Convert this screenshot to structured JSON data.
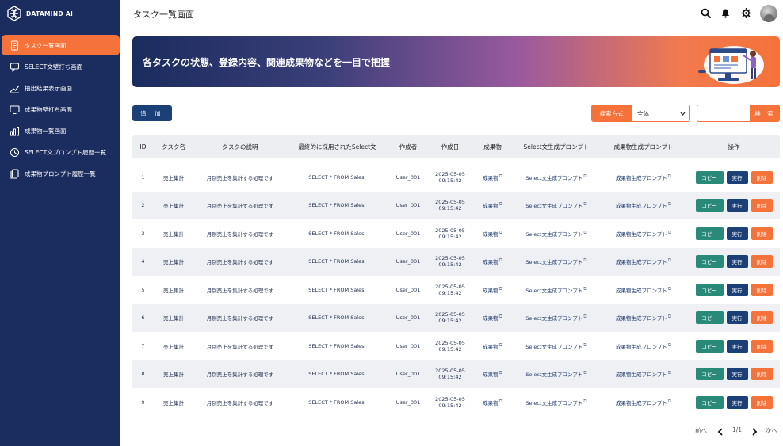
{
  "brand": {
    "name": "DATAMIND AI"
  },
  "sidebar": {
    "items": [
      {
        "label": "タスク一覧画面",
        "icon": "document-icon",
        "active": true
      },
      {
        "label": "SELECT文壁打ち画面",
        "icon": "chat-icon",
        "active": false
      },
      {
        "label": "抽出結果表示画面",
        "icon": "trend-line-icon",
        "active": false
      },
      {
        "label": "成果物壁打ち画面",
        "icon": "monitor-icon",
        "active": false
      },
      {
        "label": "成果物一覧画面",
        "icon": "bar-chart-icon",
        "active": false
      },
      {
        "label": "SELECT文プロンプト履歴一覧",
        "icon": "history-icon",
        "active": false
      },
      {
        "label": "成果物プロンプト履歴一覧",
        "icon": "file-copy-icon",
        "active": false
      }
    ]
  },
  "header": {
    "title": "タスク一覧画面",
    "icons": [
      "search-icon",
      "bell-icon",
      "gear-icon",
      "avatar"
    ]
  },
  "banner": {
    "text": "各タスクの状態、登録内容、関連成果物などを一目で把握"
  },
  "toolbar": {
    "add_label": "追 加",
    "search_method_label": "検索方式",
    "search_select_value": "全体",
    "search_placeholder": "",
    "search_button_label": "検 索"
  },
  "table": {
    "columns": [
      "ID",
      "タスク名",
      "タスクの説明",
      "最終的に採用されたSelect文",
      "作成者",
      "作成日",
      "成果物",
      "Select文生成プロンプト",
      "成果物生成プロンプト",
      "操作"
    ],
    "rows": [
      {
        "id": "1",
        "name": "売上集計",
        "desc": "月別売上を集計する処理です",
        "select": "SELECT * FROM Sales;",
        "author": "User_001",
        "date": "2025-05-05",
        "time": "09:15:42",
        "artifact": "成果物",
        "select_prompt": "Select文生成プロンプト",
        "artifact_prompt": "成果物生成プロンプト"
      },
      {
        "id": "2",
        "name": "売上集計",
        "desc": "月別売上を集計する処理です",
        "select": "SELECT * FROM Sales;",
        "author": "User_001",
        "date": "2025-05-05",
        "time": "09:15:42",
        "artifact": "成果物",
        "select_prompt": "Select文生成プロンプト",
        "artifact_prompt": "成果物生成プロンプト"
      },
      {
        "id": "3",
        "name": "売上集計",
        "desc": "月別売上を集計する処理です",
        "select": "SELECT * FROM Sales;",
        "author": "User_001",
        "date": "2025-05-05",
        "time": "09:15:42",
        "artifact": "成果物",
        "select_prompt": "Select文生成プロンプト",
        "artifact_prompt": "成果物生成プロンプト"
      },
      {
        "id": "4",
        "name": "売上集計",
        "desc": "月別売上を集計する処理です",
        "select": "SELECT * FROM Sales;",
        "author": "User_001",
        "date": "2025-05-05",
        "time": "09:15:42",
        "artifact": "成果物",
        "select_prompt": "Select文生成プロンプト",
        "artifact_prompt": "成果物生成プロンプト"
      },
      {
        "id": "5",
        "name": "売上集計",
        "desc": "月別売上を集計する処理です",
        "select": "SELECT * FROM Sales;",
        "author": "User_001",
        "date": "2025-05-05",
        "time": "09:15:42",
        "artifact": "成果物",
        "select_prompt": "Select文生成プロンプト",
        "artifact_prompt": "成果物生成プロンプト"
      },
      {
        "id": "6",
        "name": "売上集計",
        "desc": "月別売上を集計する処理です",
        "select": "SELECT * FROM Sales;",
        "author": "User_001",
        "date": "2025-05-05",
        "time": "09:15:42",
        "artifact": "成果物",
        "select_prompt": "Select文生成プロンプト",
        "artifact_prompt": "成果物生成プロンプト"
      },
      {
        "id": "7",
        "name": "売上集計",
        "desc": "月別売上を集計する処理です",
        "select": "SELECT * FROM Sales;",
        "author": "User_001",
        "date": "2025-05-05",
        "time": "09:15:42",
        "artifact": "成果物",
        "select_prompt": "Select文生成プロンプト",
        "artifact_prompt": "成果物生成プロンプト"
      },
      {
        "id": "8",
        "name": "売上集計",
        "desc": "月別売上を集計する処理です",
        "select": "SELECT * FROM Sales;",
        "author": "User_001",
        "date": "2025-05-05",
        "time": "09:15:42",
        "artifact": "成果物",
        "select_prompt": "Select文生成プロンプト",
        "artifact_prompt": "成果物生成プロンプト"
      },
      {
        "id": "9",
        "name": "売上集計",
        "desc": "月別売上を集計する処理です",
        "select": "SELECT * FROM Sales;",
        "author": "User_001",
        "date": "2025-05-05",
        "time": "09:15:42",
        "artifact": "成果物",
        "select_prompt": "Select文生成プロンプト",
        "artifact_prompt": "成果物生成プロンプト"
      }
    ],
    "actions": {
      "copy": "コピー",
      "run": "実行",
      "delete": "削除"
    }
  },
  "pagination": {
    "prev_label": "前へ",
    "page_text": "1/1",
    "next_label": "次へ"
  },
  "colors": {
    "sidebar": "#1b2c5e",
    "accent": "#f5723a",
    "primary": "#1b3f77",
    "copy": "#2a8a7a"
  }
}
